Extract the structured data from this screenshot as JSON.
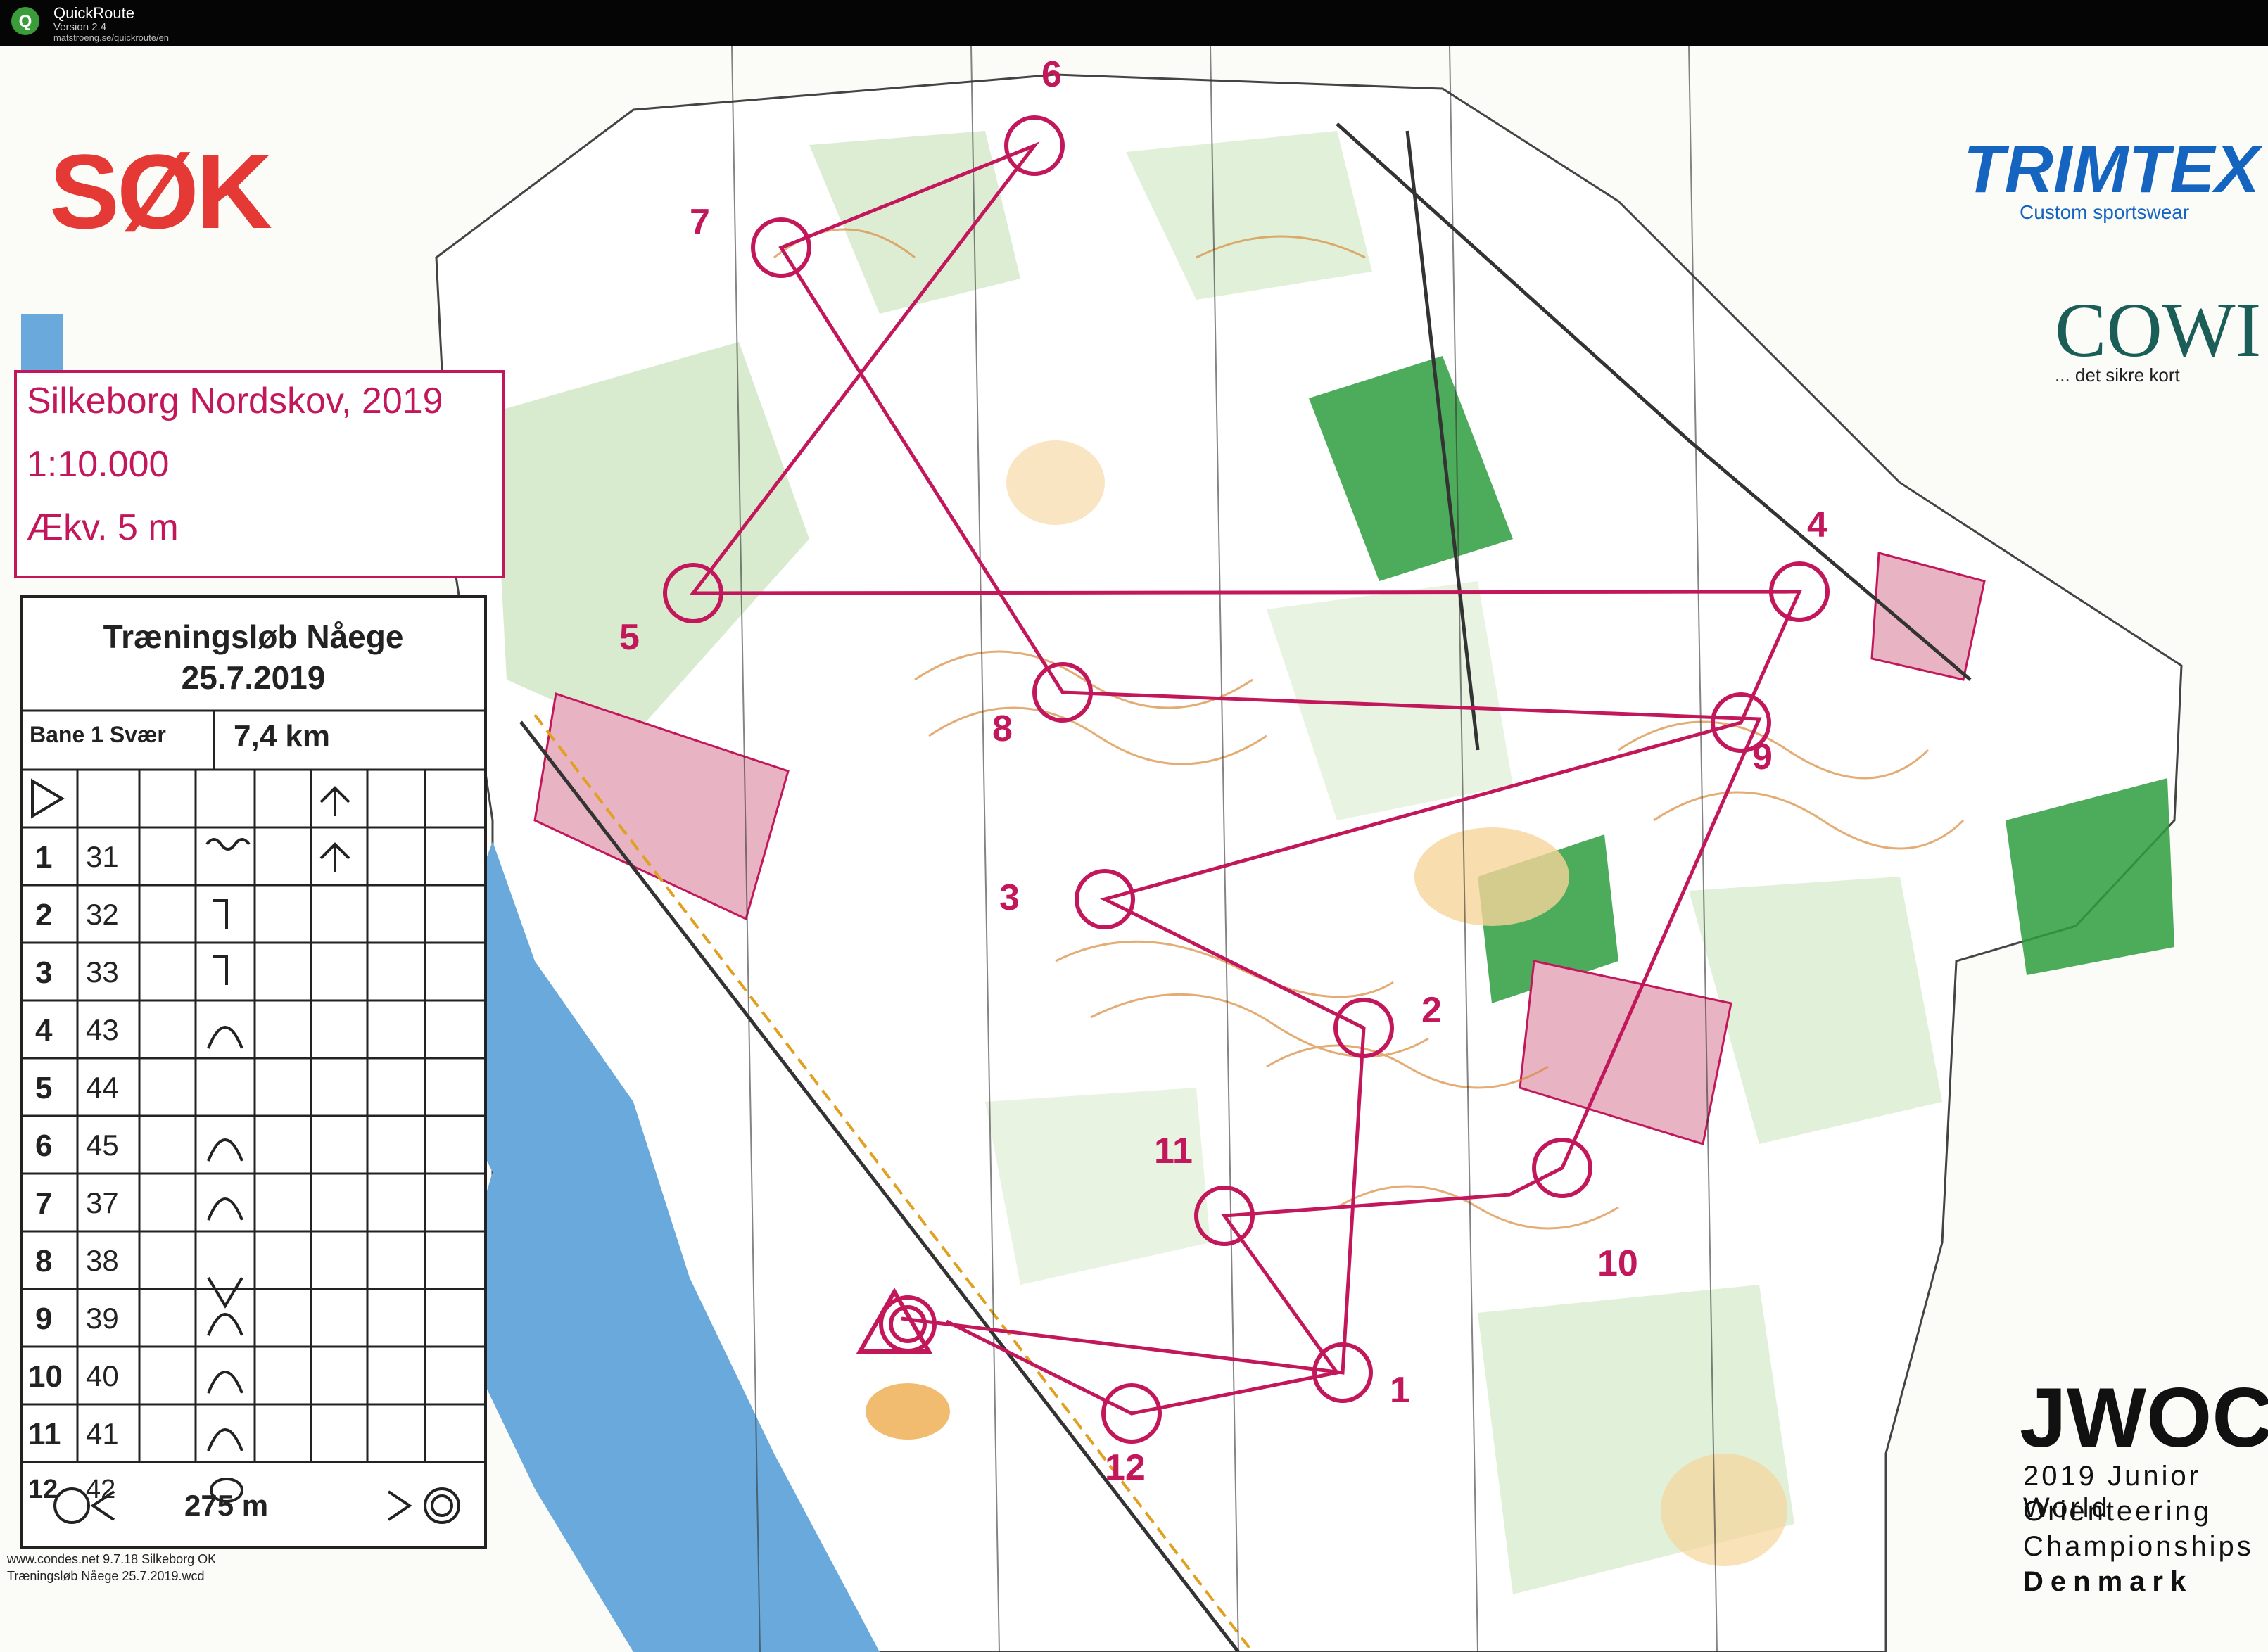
{
  "titlebar": {
    "app_name": "QuickRoute",
    "version": "Version 2.4",
    "url": "matstroeng.se/quickroute/en"
  },
  "logos": {
    "club": "SØK",
    "sponsor1": "TRIMTEX",
    "sponsor1_tagline": "Custom sportswear",
    "sponsor2": "COWI",
    "sponsor2_tagline": "... det sikre kort",
    "event": "JWOC",
    "event_lines": [
      "2019 Junior World",
      "Orienteering",
      "Championships",
      "Denmark"
    ]
  },
  "map_info": {
    "name": "Silkeborg Nordskov, 2019",
    "scale": "1:10.000",
    "contour": "Ækv. 5 m"
  },
  "description_sheet": {
    "title": "Træningsløb Nåege",
    "date": "25.7.2019",
    "course": "Bane 1 Svær",
    "length": "7,4 km",
    "rows": [
      {
        "num": "1",
        "code": "31"
      },
      {
        "num": "2",
        "code": "32"
      },
      {
        "num": "3",
        "code": "33"
      },
      {
        "num": "4",
        "code": "43"
      },
      {
        "num": "5",
        "code": "44"
      },
      {
        "num": "6",
        "code": "45"
      },
      {
        "num": "7",
        "code": "37"
      },
      {
        "num": "8",
        "code": "38"
      },
      {
        "num": "9",
        "code": "39"
      },
      {
        "num": "10",
        "code": "40"
      },
      {
        "num": "11",
        "code": "41"
      },
      {
        "num": "12",
        "code": "42"
      }
    ],
    "finish_distance": "275 m"
  },
  "footer": {
    "line1": "www.condes.net 9.7.18 Silkeborg OK",
    "line2": "Træningsløb Nåege 25.7.2019.wcd"
  },
  "controls": [
    {
      "label": "1"
    },
    {
      "label": "2"
    },
    {
      "label": "3"
    },
    {
      "label": "4"
    },
    {
      "label": "5"
    },
    {
      "label": "6"
    },
    {
      "label": "7"
    },
    {
      "label": "8"
    },
    {
      "label": "9"
    },
    {
      "label": "10"
    },
    {
      "label": "11"
    },
    {
      "label": "12"
    }
  ],
  "colors": {
    "course": "#c2185b",
    "forest": "#cfe6c2",
    "green_dark": "#2e9e3e",
    "water": "#6aa9dc",
    "contour": "#d88a3a",
    "open": "#f6d49a"
  }
}
